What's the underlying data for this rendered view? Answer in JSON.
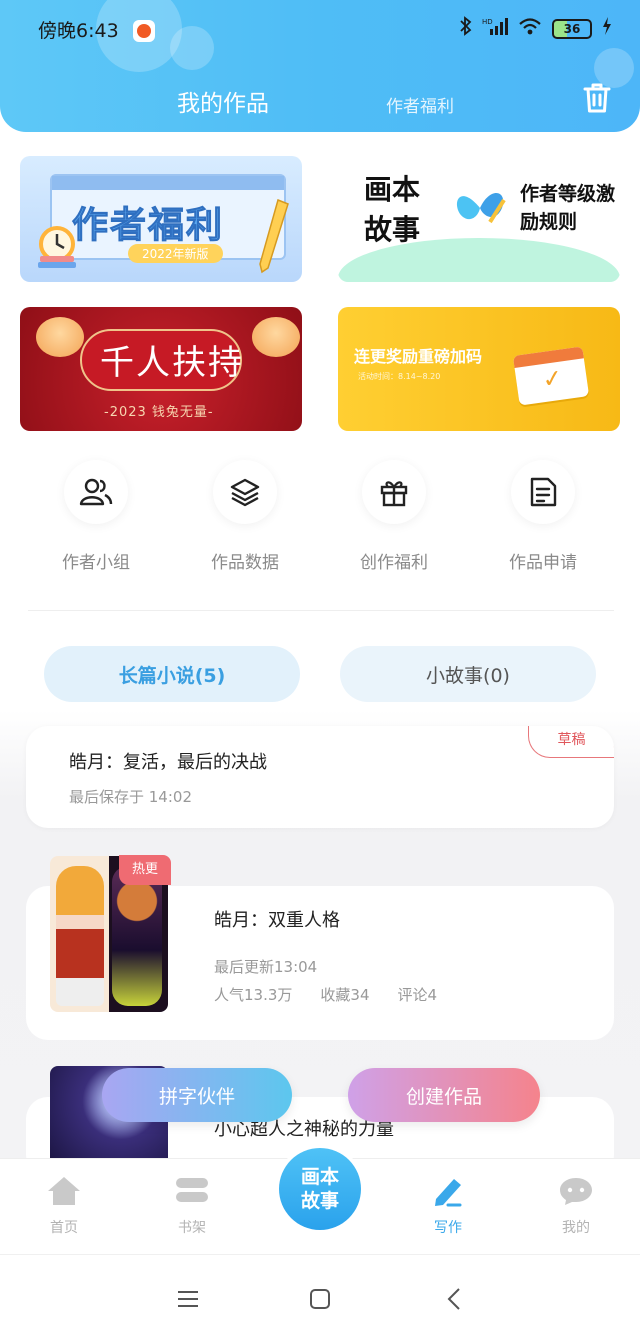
{
  "status_bar": {
    "time": "傍晚6:43",
    "battery": "36"
  },
  "header": {
    "tab_active": "我的作品",
    "tab_other": "作者福利"
  },
  "banners": {
    "b1_title": "作者福利",
    "b1_year": "2022年新版",
    "b2_title": "画本故事",
    "b2_rule": "作者等级激励规则",
    "b3_title": "千人扶持",
    "b3_sub": "-2023 钱兔无量-",
    "b4_title": "连更奖励重磅加码",
    "b4_sub": "活动时间：8.14~8.20"
  },
  "quick_entries": [
    {
      "label": "作者小组",
      "icon": "users-icon"
    },
    {
      "label": "作品数据",
      "icon": "layers-icon"
    },
    {
      "label": "创作福利",
      "icon": "gift-icon"
    },
    {
      "label": "作品申请",
      "icon": "document-icon"
    }
  ],
  "segments": {
    "long": "长篇小说(5)",
    "short": "小故事(0)"
  },
  "works": {
    "draft": {
      "title": "皓月：复活，最后的决战",
      "saved": "最后保存于 14:02",
      "badge": "草稿"
    },
    "hot": {
      "badge": "热更",
      "title": "皓月：双重人格",
      "updated": "最后更新13:04",
      "popularity": "人气13.3万",
      "favorites": "收藏34",
      "comments": "评论4"
    },
    "third": {
      "title": "小心超人之神秘的力量"
    }
  },
  "float_buttons": {
    "partner": "拼字伙伴",
    "create": "创建作品"
  },
  "bottom_nav": {
    "home": "首页",
    "shelf": "书架",
    "center": "画本故事",
    "write": "写作",
    "mine": "我的"
  },
  "colors": {
    "accent": "#3aa8ea",
    "header": "#4fbdf6",
    "draft": "#e0575c",
    "hot": "#ef6b72"
  }
}
